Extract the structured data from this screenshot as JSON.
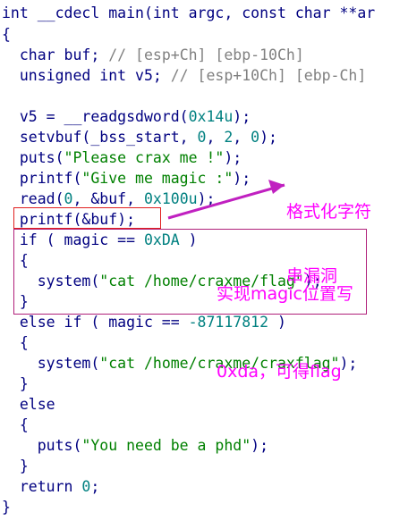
{
  "code": {
    "l1": "int __cdecl main(int argc, const char **ar",
    "l2": "{",
    "l3_code": "  char buf; ",
    "l3_comment": "// [esp+Ch] [ebp-10Ch]",
    "l4_code": "  unsigned int v5; ",
    "l4_comment": "// [esp+10Ch] [ebp-Ch]",
    "l6_a": "  v5 = __readgsdword(",
    "l6_n": "0x14u",
    "l6_b": ");",
    "l7_a": "  setvbuf(_bss_start, ",
    "l7_n1": "0",
    "l7_c1": ", ",
    "l7_n2": "2",
    "l7_c2": ", ",
    "l7_n3": "0",
    "l7_b": ");",
    "l8_a": "  puts(",
    "l8_s": "\"Please crax me !\"",
    "l8_b": ");",
    "l9_a": "  printf(",
    "l9_s": "\"Give me magic :\"",
    "l9_b": ");",
    "l10_a": "  read(",
    "l10_n1": "0",
    "l10_c": ", &buf, ",
    "l10_n2": "0x100u",
    "l10_b": ");",
    "l11": "  printf(&buf);",
    "l12_a": "  if ( magic == ",
    "l12_n": "0xDA",
    "l12_b": " )",
    "l13": "  {",
    "l14_a": "    system(",
    "l14_s": "\"cat /home/craxme/flag\"",
    "l14_b": ");",
    "l15": "  }",
    "l16_a": "  else if ( magic == ",
    "l16_n": "-87117812",
    "l16_b": " )",
    "l17": "  {",
    "l18_a": "    system(",
    "l18_s": "\"cat /home/craxme/craxflag\"",
    "l18_b": ");",
    "l19": "  }",
    "l20": "  else",
    "l21": "  {",
    "l22_a": "    puts(",
    "l22_s": "\"You need be a phd\"",
    "l22_b": ");",
    "l23": "  }",
    "l24_a": "  return ",
    "l24_n": "0",
    "l24_b": ";",
    "l25": "}"
  },
  "annotations": {
    "format_string_line1": "格式化字符",
    "format_string_line2": "串漏洞",
    "magic_line1": "实现magic位置写",
    "magic_line2": "0xda，可得flag"
  },
  "colors": {
    "code": "#000080",
    "comment": "#808080",
    "number": "#008080",
    "string": "#008000",
    "annotation": "#ff00ff",
    "box_red": "#e02020",
    "box_magenta": "#b0207a"
  }
}
